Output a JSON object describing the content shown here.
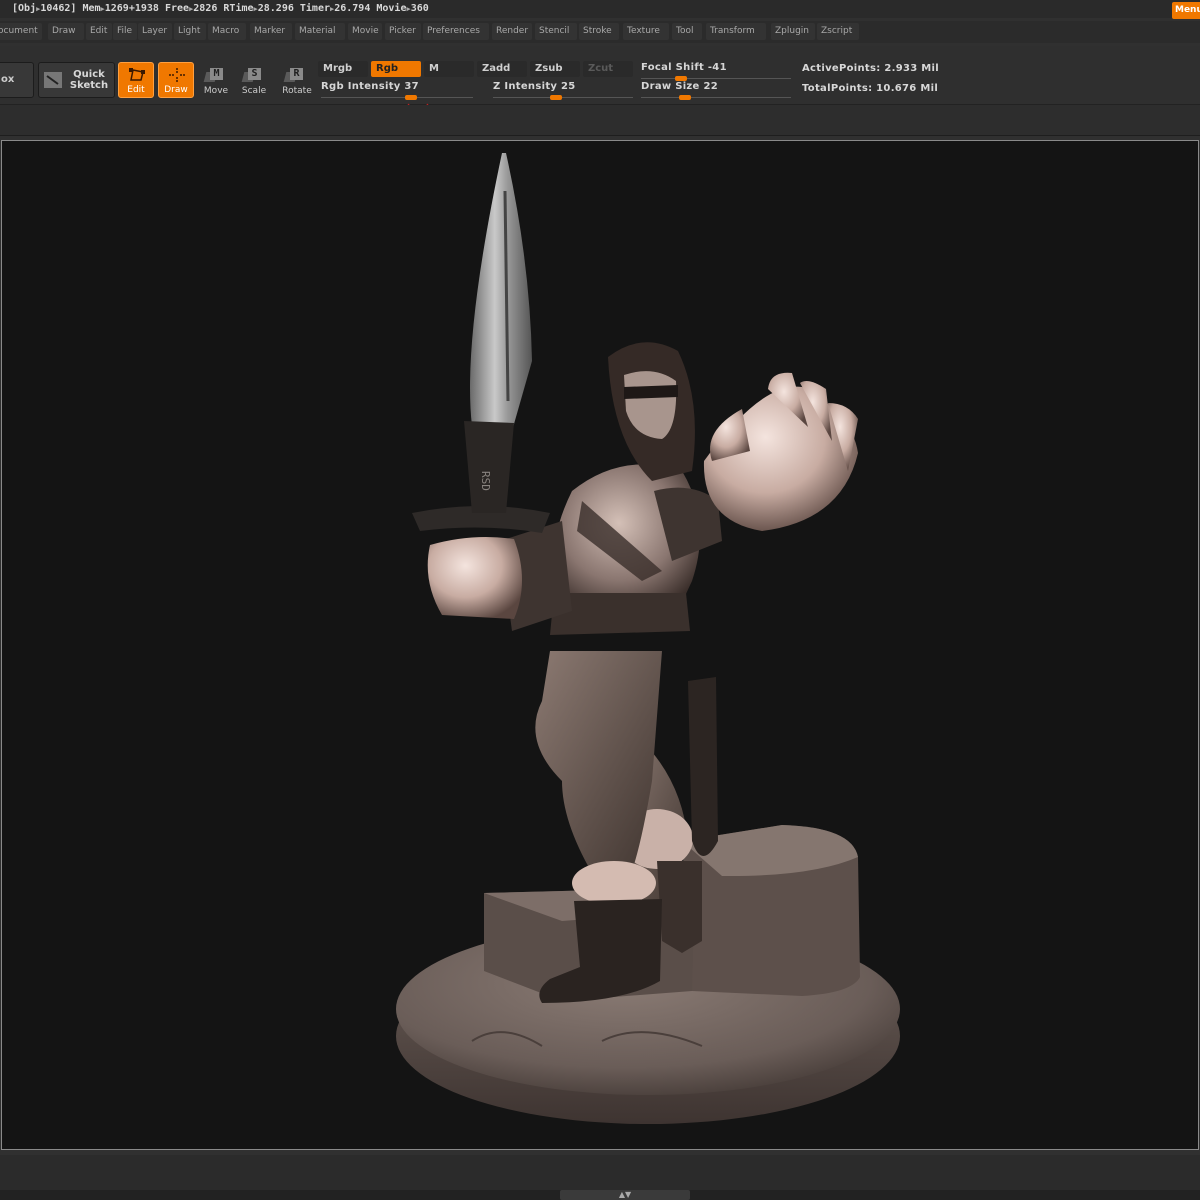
{
  "status": {
    "obj": "[Obj",
    "obj_count": "10462]",
    "mem_label": "Mem",
    "mem_value": "1269+1938",
    "free_label": "Free",
    "free_value": "2826",
    "rtime_label": "RTime",
    "rtime_value": "28.296",
    "timer_label": "Timer",
    "timer_value": "26.794",
    "movie_label": "Movie",
    "movie_value": "360",
    "menus_button": "Menu"
  },
  "menubar": {
    "items": [
      "ocument",
      "Draw",
      "Edit",
      "File",
      "Layer",
      "Light",
      "Macro",
      "Marker",
      "Material",
      "Movie",
      "Picker",
      "Preferences",
      "Render",
      "Stencil",
      "Stroke",
      "Texture",
      "Tool",
      "Transform",
      "Zplugin",
      "Zscript"
    ]
  },
  "toolbar": {
    "lightbox_partial": "ox",
    "quick_sketch": "Quick Sketch",
    "edit": "Edit",
    "draw": "Draw",
    "move": "Move",
    "move_glyph": "M",
    "scale": "Scale",
    "scale_glyph": "S",
    "rotate": "Rotate",
    "rotate_glyph": "R",
    "mrgb": "Mrgb",
    "rgb": "Rgb",
    "m": "M",
    "zadd": "Zadd",
    "zsub": "Zsub",
    "zcut": "Zcut",
    "rgb_intensity_label": "Rgb Intensity",
    "rgb_intensity_value": "37",
    "z_intensity_label": "Z Intensity",
    "z_intensity_value": "25",
    "focal_shift_label": "Focal Shift",
    "focal_shift_value": "-41",
    "draw_size_label": "Draw Size",
    "draw_size_value": "22",
    "active_points": "ActivePoints: 2.933 Mil",
    "total_points": "TotalPoints: 10.676 Mil"
  },
  "colors": {
    "accent": "#f07800",
    "canvas_bg": "#141414",
    "ui_bg": "#2f2f2f"
  }
}
